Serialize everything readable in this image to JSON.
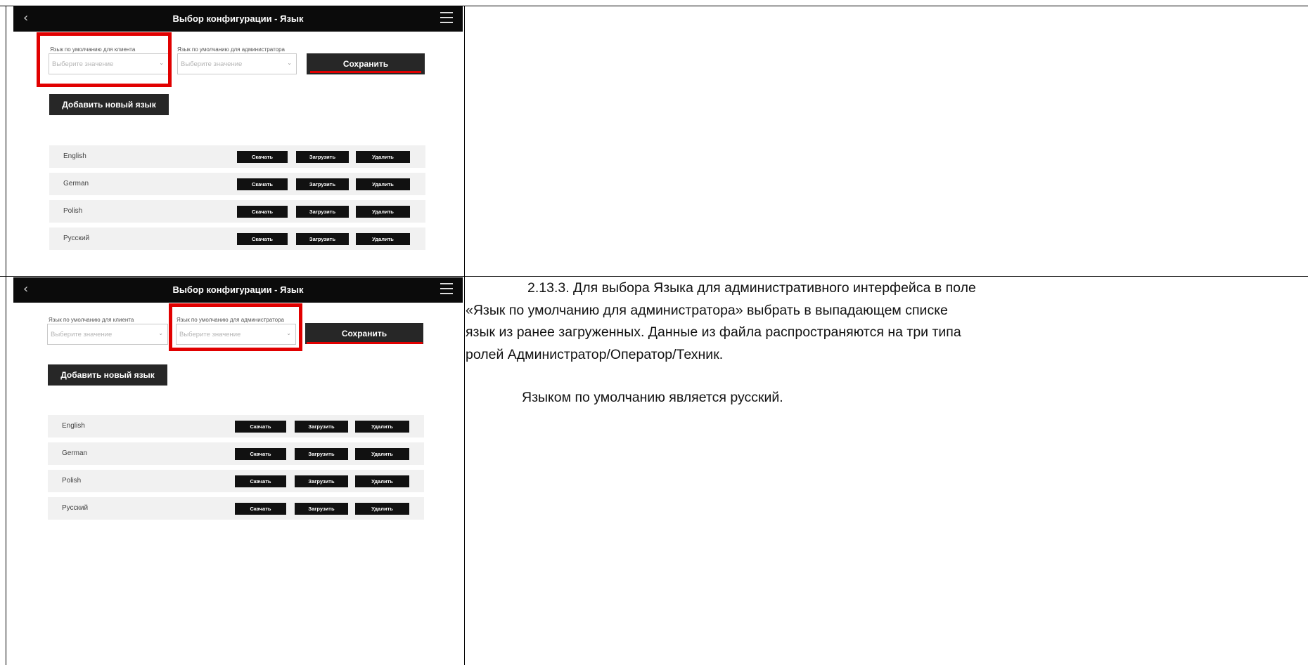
{
  "screens": [
    {
      "title": "Выбор конфигурации - Язык",
      "client_label": "Язык по умолчанию для клиента",
      "admin_label": "Язык по умолчанию для администратора",
      "client_placeholder": "Выберите значение",
      "admin_placeholder": "Выберите значение",
      "save": "Сохранить",
      "add_language": "Добавить новый язык",
      "highlight": "client-language-select",
      "languages": [
        {
          "name": "English",
          "download": "Скачать",
          "upload": "Загрузить",
          "delete": "Удалить"
        },
        {
          "name": "German",
          "download": "Скачать",
          "upload": "Загрузить",
          "delete": "Удалить"
        },
        {
          "name": "Polish",
          "download": "Скачать",
          "upload": "Загрузить",
          "delete": "Удалить"
        },
        {
          "name": "Русский",
          "download": "Скачать",
          "upload": "Загрузить",
          "delete": "Удалить"
        }
      ]
    },
    {
      "title": "Выбор конфигурации - Язык",
      "client_label": "Язык по умолчанию для клиента",
      "admin_label": "Язык по умолчанию для администратора",
      "client_placeholder": "Выберите значение",
      "admin_placeholder": "Выберите значение",
      "save": "Сохранить",
      "add_language": "Добавить новый язык",
      "highlight": "admin-language-select",
      "languages": [
        {
          "name": "English",
          "download": "Скачать",
          "upload": "Загрузить",
          "delete": "Удалить"
        },
        {
          "name": "German",
          "download": "Скачать",
          "upload": "Загрузить",
          "delete": "Удалить"
        },
        {
          "name": "Polish",
          "download": "Скачать",
          "upload": "Загрузить",
          "delete": "Удалить"
        },
        {
          "name": "Русский",
          "download": "Скачать",
          "upload": "Загрузить",
          "delete": "Удалить"
        }
      ]
    }
  ],
  "instruction": {
    "lines": [
      "2.13.3. Для выбора Языка для административного интерфейса в поле",
      "«Язык по умолчанию для администратора» выбрать в выпадающем списке",
      "язык из ранее загруженных. Данные из файла распространяются на три типа",
      "ролей Администратор/Оператор/Техник."
    ],
    "note": "Языком по умолчанию является русский."
  },
  "colors": {
    "highlight": "#e10000",
    "topbar": "#0b0b0b",
    "button": "#272727",
    "row_bg": "#f1f1f1"
  },
  "icons": [
    "back-chevron-icon",
    "hamburger-menu-icon",
    "dropdown-chevron-icon"
  ]
}
